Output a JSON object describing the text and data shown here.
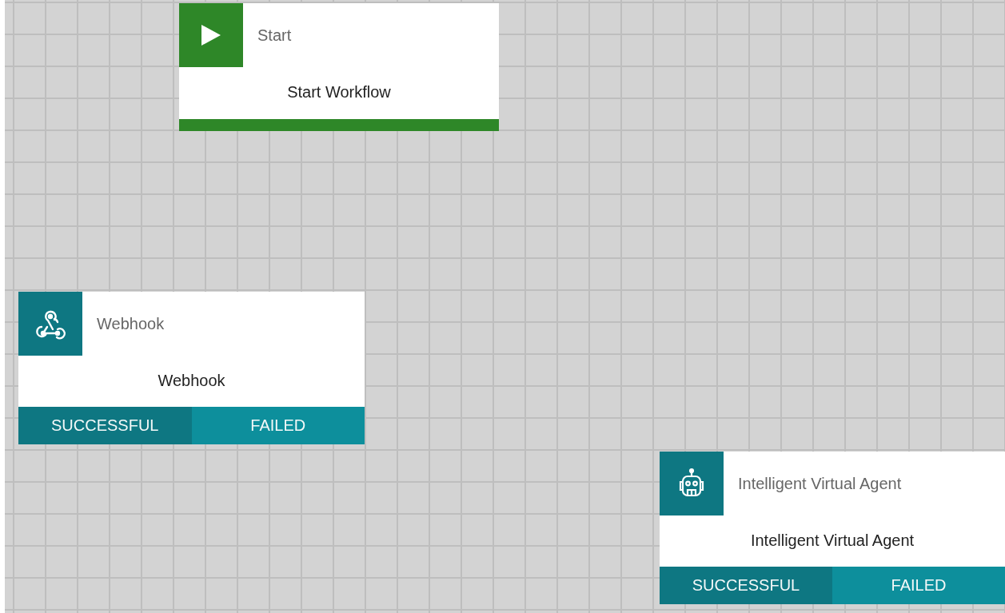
{
  "nodes": [
    {
      "kind": "start",
      "type_label": "Start",
      "title": "Start Workflow"
    },
    {
      "kind": "action",
      "type_label": "Webhook",
      "title": "Webhook",
      "outcomes": [
        "SUCCESSFUL",
        "FAILED"
      ]
    },
    {
      "kind": "action",
      "type_label": "Intelligent Virtual Agent",
      "title": "Intelligent Virtual Agent",
      "outcomes": [
        "SUCCESSFUL",
        "FAILED"
      ]
    }
  ]
}
